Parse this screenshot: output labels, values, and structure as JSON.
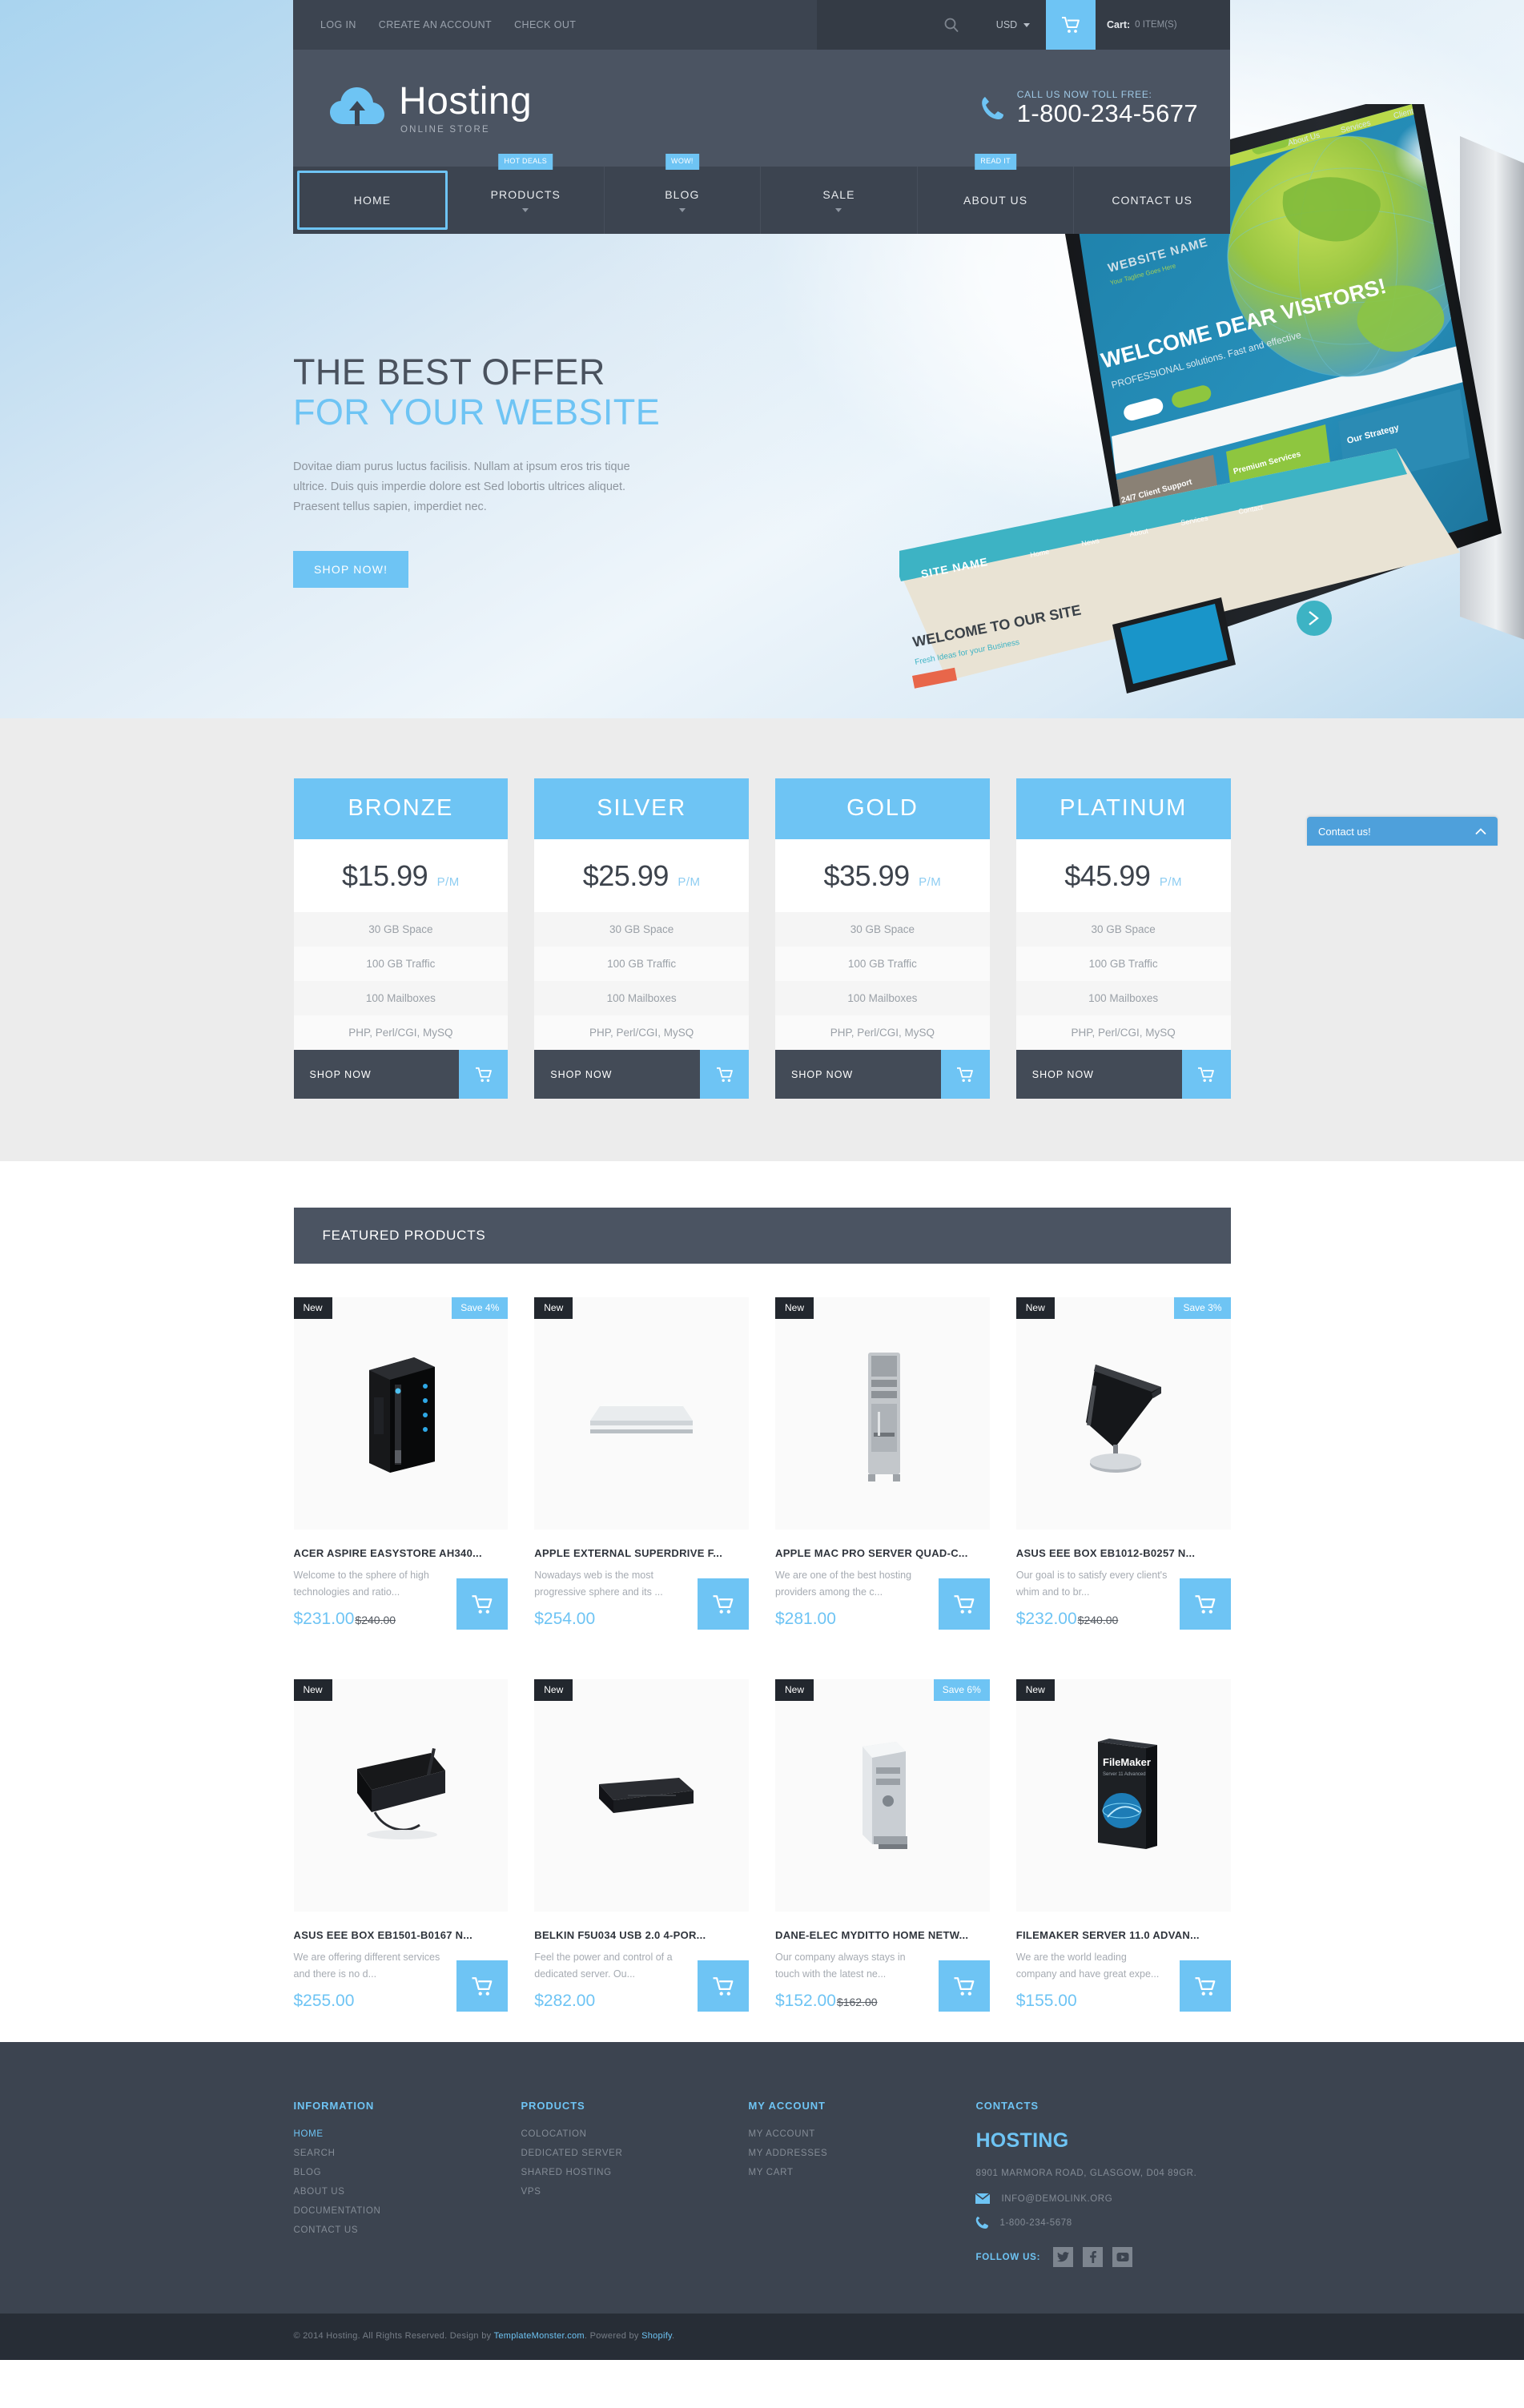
{
  "topbar": {
    "links": [
      "LOG IN",
      "CREATE AN ACCOUNT",
      "CHECK OUT"
    ],
    "currency": "USD",
    "cart_label": "Cart:",
    "cart_qty": "0 ITEM(S)"
  },
  "header": {
    "logo_title": "Hosting",
    "logo_sub": "ONLINE STORE",
    "phone_label": "CALL US NOW TOLL FREE:",
    "phone_number": "1-800-234-5677"
  },
  "nav": {
    "items": [
      {
        "label": "HOME",
        "badge": "",
        "caret": false,
        "active": true
      },
      {
        "label": "PRODUCTS",
        "badge": "HOT DEALS",
        "caret": true,
        "active": false
      },
      {
        "label": "BLOG",
        "badge": "WOW!",
        "caret": true,
        "active": false
      },
      {
        "label": "SALE",
        "badge": "",
        "caret": true,
        "active": false
      },
      {
        "label": "ABOUT US",
        "badge": "READ IT",
        "caret": false,
        "active": false
      },
      {
        "label": "CONTACT US",
        "badge": "",
        "caret": false,
        "active": false
      }
    ]
  },
  "hero": {
    "title_line1": "THE BEST OFFER",
    "title_line2": "FOR YOUR WEBSITE",
    "paragraph": "Dovitae diam purus luctus facilisis. Nullam at ipsum eros tris tique ultrice. Duis quis imperdie dolore est Sed lobortis ultrices aliquet. Praesent tellus sapien, imperdiet nec.",
    "button": "SHOP NOW!"
  },
  "contact_tab": {
    "label": "Contact us!"
  },
  "pricing": {
    "features": [
      "30 GB Space",
      "100 GB Traffic",
      "100 Mailboxes",
      "PHP, Perl/CGI, MySQ"
    ],
    "shop_label": "SHOP NOW",
    "per_month": "P/M",
    "plans": [
      {
        "name": "BRONZE",
        "price": "$15.99"
      },
      {
        "name": "SILVER",
        "price": "$25.99"
      },
      {
        "name": "GOLD",
        "price": "$35.99"
      },
      {
        "name": "PLATINUM",
        "price": "$45.99"
      }
    ]
  },
  "featured": {
    "heading": "FEATURED PRODUCTS",
    "rows": [
      [
        {
          "badge_new": "New",
          "badge_save": "Save 4%",
          "title": "ACER ASPIRE EASYSTORE AH340...",
          "desc": "Welcome to the sphere of high technologies and ratio...",
          "price": "$231.00",
          "old_price": "$240.00",
          "image": "tower-server"
        },
        {
          "badge_new": "New",
          "badge_save": "",
          "title": "APPLE EXTERNAL SUPERDRIVE F...",
          "desc": "Nowadays web is the most progressive sphere and its ...",
          "price": "$254.00",
          "old_price": "",
          "image": "external-drive"
        },
        {
          "badge_new": "New",
          "badge_save": "",
          "title": "APPLE MAC PRO SERVER QUAD-C...",
          "desc": "We are one of the best hosting providers among the c...",
          "price": "$281.00",
          "old_price": "",
          "image": "mac-pro-tower"
        },
        {
          "badge_new": "New",
          "badge_save": "Save 3%",
          "title": "ASUS EEE BOX EB1012-B0257 N...",
          "desc": "Our goal is to satisfy every client's whim and to br...",
          "price": "$232.00",
          "old_price": "$240.00",
          "image": "eee-box-stand"
        }
      ],
      [
        {
          "badge_new": "New",
          "badge_save": "",
          "title": "ASUS EEE BOX EB1501-B0167 N...",
          "desc": "We are offering different services and there is no d...",
          "price": "$255.00",
          "old_price": "",
          "image": "router-antenna"
        },
        {
          "badge_new": "New",
          "badge_save": "",
          "title": "BELKIN F5U034 USB 2.0 4-POR...",
          "desc": "Feel the power and control of a dedicated server. Ou...",
          "price": "$282.00",
          "old_price": "",
          "image": "usb-hub"
        },
        {
          "badge_new": "New",
          "badge_save": "Save 6%",
          "title": "DANE-ELEC MYDITTO HOME NETW...",
          "desc": "Our company always stays in touch with the latest ne...",
          "price": "$152.00",
          "old_price": "$162.00",
          "image": "nas-box"
        },
        {
          "badge_new": "New",
          "badge_save": "",
          "title": "FILEMAKER SERVER 11.0 ADVAN...",
          "desc": "We are the world leading company and have great expe...",
          "price": "$155.00",
          "old_price": "",
          "image": "software-box"
        }
      ]
    ]
  },
  "footer": {
    "columns": [
      {
        "heading": "INFORMATION",
        "links": [
          "HOME",
          "SEARCH",
          "BLOG",
          "ABOUT US",
          "DOCUMENTATION",
          "CONTACT US"
        ],
        "active_index": 0
      },
      {
        "heading": "PRODUCTS",
        "links": [
          "COLOCATION",
          "DEDICATED SERVER",
          "SHARED HOSTING",
          "VPS"
        ],
        "active_index": -1
      },
      {
        "heading": "MY ACCOUNT",
        "links": [
          "MY ACCOUNT",
          "MY ADDRESSES",
          "MY CART"
        ],
        "active_index": -1
      }
    ],
    "contacts": {
      "heading": "CONTACTS",
      "brand": "HOSTING",
      "address": "8901 MARMORA ROAD, GLASGOW, D04 89GR.",
      "email": "INFO@DEMOLINK.ORG",
      "phone": "1-800-234-5678",
      "follow_label": "FOLLOW US:",
      "socials": [
        "twitter-icon",
        "facebook-icon",
        "youtube-icon"
      ]
    },
    "copyright_pre": "© 2014 Hosting. All Rights Reserved. Design by ",
    "copyright_link1": "TemplateMonster.com",
    "copyright_mid": ". Powered by ",
    "copyright_link2": "Shopify",
    "copyright_end": "."
  },
  "colors": {
    "accent": "#6ec4f4",
    "dark": "#3c4450",
    "darker": "#272d36",
    "panel": "#4b5462"
  }
}
